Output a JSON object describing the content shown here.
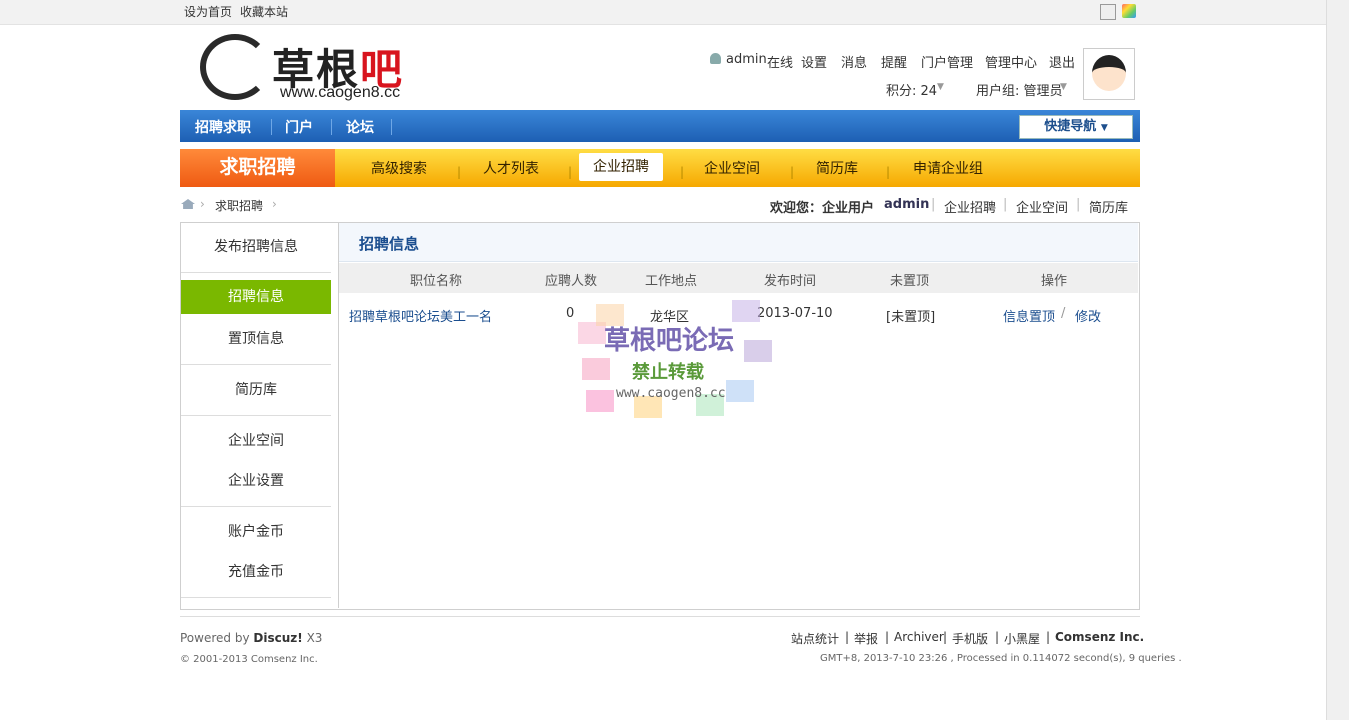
{
  "topbar": {
    "set_home": "设为首页",
    "bookmark": "收藏本站"
  },
  "logo": {
    "main": "草根",
    "red": "吧",
    "url": "www.caogen8.cc"
  },
  "user": {
    "name": "admin",
    "status": "在线",
    "links": [
      "设置",
      "消息",
      "提醒",
      "门户管理",
      "管理中心",
      "退出"
    ],
    "points": "积分: 24",
    "group": "用户组: 管理员"
  },
  "bluenav": {
    "items": [
      "招聘求职",
      "门户",
      "论坛"
    ],
    "quick": "快捷导航"
  },
  "orangenav": {
    "title": "求职招聘",
    "items": [
      "高级搜索",
      "人才列表",
      "企业招聘",
      "企业空间",
      "简历库",
      "申请企业组"
    ],
    "active": "企业招聘"
  },
  "breadcrumb": {
    "current": "求职招聘"
  },
  "welcome": {
    "text": "欢迎您：企业用户",
    "user": "admin",
    "links": [
      "企业招聘",
      "企业空间",
      "简历库"
    ]
  },
  "sidebar": {
    "items": [
      "发布招聘信息",
      "招聘信息",
      "置顶信息",
      "简历库",
      "企业空间",
      "企业设置",
      "账户金币",
      "充值金币"
    ]
  },
  "panel": {
    "title": "招聘信息",
    "columns": [
      "职位名称",
      "应聘人数",
      "工作地点",
      "发布时间",
      "未置顶",
      "操作"
    ],
    "rows": [
      {
        "name": "招聘草根吧论坛美工一名",
        "applicants": "0",
        "location": "龙华区",
        "date": "2013-07-10",
        "top": "[未置顶]",
        "actions": [
          "信息置顶",
          "修改"
        ]
      }
    ]
  },
  "stamp": {
    "title": "草根吧论坛",
    "sub": "禁止转载",
    "url": "www.caogen8.cc"
  },
  "footer": {
    "powered": "Powered by",
    "brand": "Discuz!",
    "ver": "X3",
    "copy": "© 2001-2013 Comsenz Inc.",
    "links": [
      "站点统计",
      "举报",
      "Archiver",
      "手机版",
      "小黑屋"
    ],
    "company": "Comsenz Inc.",
    "stats": "GMT+8, 2013-7-10 23:26 , Processed in 0.114072 second(s), 9 queries ."
  }
}
